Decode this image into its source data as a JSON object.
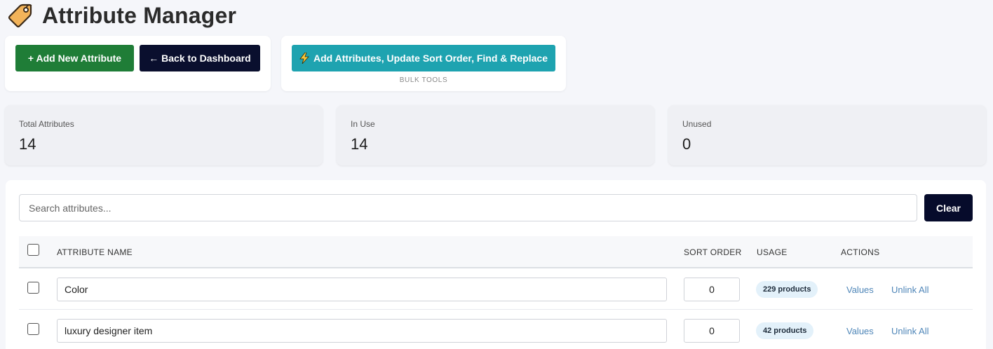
{
  "header": {
    "title": "Attribute Manager",
    "icon": "tag-icon"
  },
  "toolbar": {
    "add_label": "+ Add New Attribute",
    "back_label": "← Back to Dashboard",
    "bulk_label": "Add Attributes, Update Sort Order, Find & Replace",
    "bulk_caption": "BULK TOOLS"
  },
  "stats": [
    {
      "label": "Total Attributes",
      "value": "14"
    },
    {
      "label": "In Use",
      "value": "14"
    },
    {
      "label": "Unused",
      "value": "0"
    }
  ],
  "search": {
    "placeholder": "Search attributes...",
    "value": "",
    "clear_label": "Clear"
  },
  "table": {
    "columns": [
      "ATTRIBUTE NAME",
      "SORT ORDER",
      "USAGE",
      "ACTIONS"
    ],
    "rows": [
      {
        "name": "Color",
        "sort_order": "0",
        "usage": "229 products",
        "values_label": "Values",
        "unlink_label": "Unlink All"
      },
      {
        "name": "luxury designer item",
        "sort_order": "0",
        "usage": "42 products",
        "values_label": "Values",
        "unlink_label": "Unlink All"
      }
    ]
  },
  "colors": {
    "primary_green": "#1f7d37",
    "navy": "#0a0f2e",
    "teal": "#1ea3b0",
    "link": "#4f86b8",
    "badge_bg": "#e3f1fa"
  }
}
